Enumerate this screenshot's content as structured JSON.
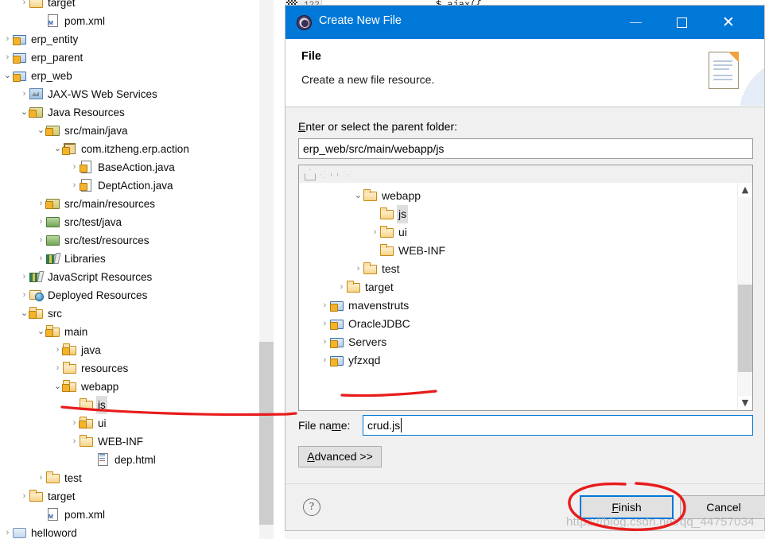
{
  "explorer": {
    "name": "package-explorer",
    "items": [
      {
        "label": "target",
        "indent": 1,
        "twisty": "right",
        "icon": "folder",
        "sel": false
      },
      {
        "label": "pom.xml",
        "indent": 2,
        "twisty": "none",
        "icon": "xmlfile",
        "sel": false
      },
      {
        "label": "erp_entity",
        "indent": 0,
        "twisty": "right",
        "icon": "maven",
        "sel": false
      },
      {
        "label": "erp_parent",
        "indent": 0,
        "twisty": "right",
        "icon": "maven",
        "sel": false
      },
      {
        "label": "erp_web",
        "indent": 0,
        "twisty": "down",
        "icon": "maven",
        "sel": false
      },
      {
        "label": "JAX-WS Web Services",
        "indent": 1,
        "twisty": "right",
        "icon": "ws",
        "sel": false
      },
      {
        "label": "Java Resources",
        "indent": 1,
        "twisty": "down",
        "icon": "pkgsrc",
        "sel": false
      },
      {
        "label": "src/main/java",
        "indent": 2,
        "twisty": "down",
        "icon": "pkgsrc",
        "sel": false
      },
      {
        "label": "com.itzheng.erp.action",
        "indent": 3,
        "twisty": "down",
        "icon": "pkg",
        "sel": false
      },
      {
        "label": "BaseAction.java",
        "indent": 4,
        "twisty": "right",
        "icon": "javafile",
        "sel": false
      },
      {
        "label": "DeptAction.java",
        "indent": 4,
        "twisty": "right",
        "icon": "javafile",
        "sel": false
      },
      {
        "label": "src/main/resources",
        "indent": 2,
        "twisty": "right",
        "icon": "pkgsrc",
        "sel": false
      },
      {
        "label": "src/test/java",
        "indent": 2,
        "twisty": "right",
        "icon": "pkgsrc-green",
        "sel": false
      },
      {
        "label": "src/test/resources",
        "indent": 2,
        "twisty": "right",
        "icon": "pkgsrc-green",
        "sel": false
      },
      {
        "label": "Libraries",
        "indent": 2,
        "twisty": "right",
        "icon": "lib",
        "sel": false
      },
      {
        "label": "JavaScript Resources",
        "indent": 1,
        "twisty": "right",
        "icon": "lib",
        "sel": false
      },
      {
        "label": "Deployed Resources",
        "indent": 1,
        "twisty": "right",
        "icon": "deployed",
        "sel": false
      },
      {
        "label": "src",
        "indent": 1,
        "twisty": "down",
        "icon": "folder-src",
        "sel": false
      },
      {
        "label": "main",
        "indent": 2,
        "twisty": "down",
        "icon": "folder-src",
        "sel": false
      },
      {
        "label": "java",
        "indent": 3,
        "twisty": "right",
        "icon": "folder-src",
        "sel": false
      },
      {
        "label": "resources",
        "indent": 3,
        "twisty": "right",
        "icon": "folder",
        "sel": false
      },
      {
        "label": "webapp",
        "indent": 3,
        "twisty": "down",
        "icon": "folder-src",
        "sel": false
      },
      {
        "label": "js",
        "indent": 4,
        "twisty": "none",
        "icon": "folder",
        "sel": true
      },
      {
        "label": "ui",
        "indent": 4,
        "twisty": "right",
        "icon": "folder-src",
        "sel": false
      },
      {
        "label": "WEB-INF",
        "indent": 4,
        "twisty": "right",
        "icon": "folder",
        "sel": false
      },
      {
        "label": "dep.html",
        "indent": 5,
        "twisty": "none",
        "icon": "htmlfile",
        "sel": false
      },
      {
        "label": "test",
        "indent": 2,
        "twisty": "right",
        "icon": "folder",
        "sel": false
      },
      {
        "label": "target",
        "indent": 1,
        "twisty": "right",
        "icon": "folder",
        "sel": false
      },
      {
        "label": "pom.xml",
        "indent": 2,
        "twisty": "none",
        "icon": "xmlfile",
        "sel": false
      },
      {
        "label": "helloword",
        "indent": 0,
        "twisty": "right",
        "icon": "plain",
        "sel": false
      }
    ]
  },
  "background_editor": {
    "line_number": "122",
    "code_fragment": "$.ajax({"
  },
  "dialog": {
    "title": "Create New File",
    "window_buttons": {
      "minimize": "minimize-button",
      "maximize": "maximize-button",
      "close": "✕"
    },
    "header": {
      "title": "File",
      "subtitle": "Create a new file resource."
    },
    "parent_folder": {
      "label_prefix": "E",
      "label_rest": "nter or select the parent folder:",
      "value": "erp_web/src/main/webapp/js"
    },
    "toolbar": {
      "home": "home-icon",
      "back": "back-icon",
      "forward": "forward-icon"
    },
    "tree": [
      {
        "label": "webapp",
        "indent": 3,
        "twisty": "down",
        "icon": "folder",
        "sel": false
      },
      {
        "label": "js",
        "indent": 4,
        "twisty": "none",
        "icon": "folder",
        "sel": true
      },
      {
        "label": "ui",
        "indent": 4,
        "twisty": "right",
        "icon": "folder",
        "sel": false
      },
      {
        "label": "WEB-INF",
        "indent": 4,
        "twisty": "none",
        "icon": "folder",
        "sel": false
      },
      {
        "label": "test",
        "indent": 3,
        "twisty": "right",
        "icon": "folder",
        "sel": false
      },
      {
        "label": "target",
        "indent": 2,
        "twisty": "right",
        "icon": "folder",
        "sel": false
      },
      {
        "label": "mavenstruts",
        "indent": 1,
        "twisty": "right",
        "icon": "maven",
        "sel": false
      },
      {
        "label": "OracleJDBC",
        "indent": 1,
        "twisty": "right",
        "icon": "maven",
        "sel": false
      },
      {
        "label": "Servers",
        "indent": 1,
        "twisty": "right",
        "icon": "folder-blue",
        "sel": false
      },
      {
        "label": "yfzxqd",
        "indent": 1,
        "twisty": "right",
        "icon": "maven-web",
        "sel": false
      }
    ],
    "file_name": {
      "label_a": "File na",
      "label_key": "m",
      "label_b": "e:",
      "value": "crud.js"
    },
    "advanced_button": {
      "key": "A",
      "rest": "dvanced >>"
    },
    "footer": {
      "help": "?",
      "finish_key": "F",
      "finish_rest": "inish",
      "cancel": "Cancel"
    }
  },
  "watermark": "https://blog.csdn.net/qq_44757034",
  "colors": {
    "titlebar": "#0078d7",
    "dialog_bg": "#f0f0f0",
    "annotation_red": "#e81c1c",
    "selection_gray": "#dedede",
    "focus_blue": "#0078d7"
  }
}
